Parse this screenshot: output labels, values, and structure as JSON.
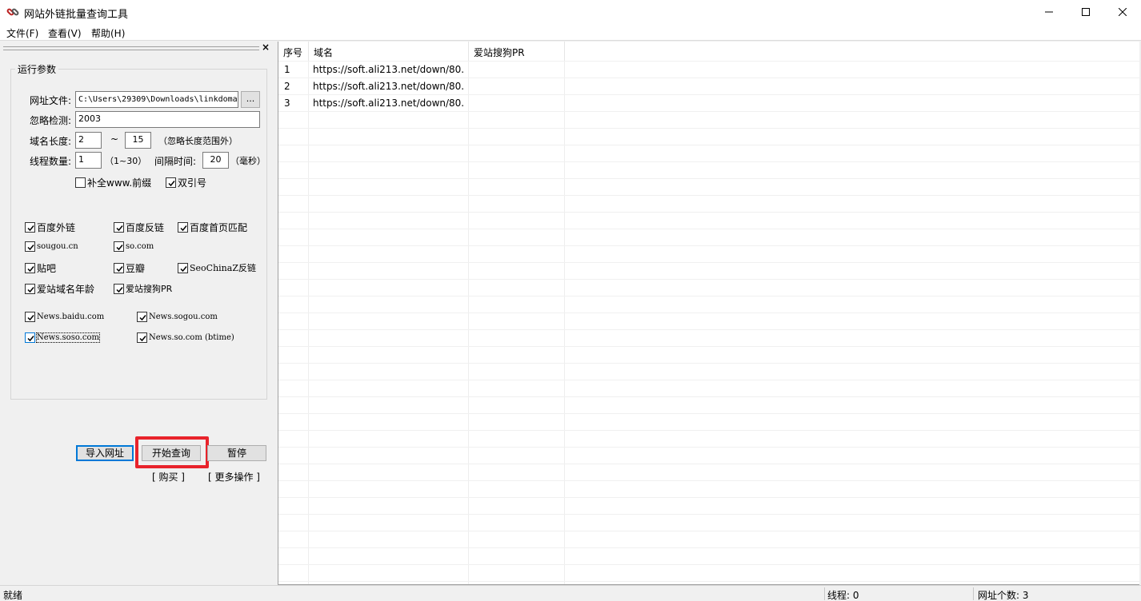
{
  "window": {
    "title": "网站外链批量查询工具",
    "icon": "chain-link-icon"
  },
  "menu": [
    {
      "label": "文件(F)"
    },
    {
      "label": "查看(V)"
    },
    {
      "label": "帮助(H)"
    }
  ],
  "left_pane": {
    "close_glyph": "×",
    "group_title": "运行参数",
    "url_file": {
      "label": "网址文件:",
      "value": "C:\\Users\\29309\\Downloads\\linkdoma",
      "browse_label": "..."
    },
    "ignore_check": {
      "label": "忽略检测:",
      "value": "2003"
    },
    "domain_length": {
      "label": "域名长度:",
      "min": "2",
      "tilde": "~",
      "max": "15",
      "note": "（忽略长度范围外）"
    },
    "threads": {
      "label": "线程数量:",
      "value": "1",
      "range": "（1~30）",
      "interval_label": "间隔时间:",
      "interval_value": "20",
      "unit": "（毫秒）"
    },
    "options": [
      {
        "label": "补全www.前缀",
        "checked": false
      },
      {
        "label": "双引号",
        "checked": true
      }
    ],
    "engines": [
      {
        "label": "百度外链",
        "checked": true
      },
      {
        "label": "百度反链",
        "checked": true
      },
      {
        "label": "百度首页匹配",
        "checked": true
      },
      {
        "label": "sougou.cn",
        "checked": true
      },
      {
        "label": "so.com",
        "checked": true
      },
      {
        "label": "贴吧",
        "checked": true
      },
      {
        "label": "豆瓣",
        "checked": true
      },
      {
        "label": "SeoChinaZ反链",
        "checked": true
      },
      {
        "label": "爱站域名年龄",
        "checked": true
      },
      {
        "label": "爱站搜狗PR",
        "checked": true
      }
    ],
    "news": [
      {
        "label": "News.baidu.com",
        "checked": true
      },
      {
        "label": "News.sogou.com",
        "checked": true
      },
      {
        "label": "News.soso.com",
        "checked": true
      },
      {
        "label": "News.so.com (btime)",
        "checked": true
      }
    ],
    "buttons": {
      "import": "导入网址",
      "start": "开始查询",
      "pause": "暂停"
    },
    "links": {
      "buy": "[ 购买 ]",
      "more": "[ 更多操作 ]"
    }
  },
  "table": {
    "headers": [
      "序号",
      "域名",
      "爱站搜狗PR"
    ],
    "rows": [
      [
        "1",
        "https://soft.ali213.net/down/80...",
        ""
      ],
      [
        "2",
        "https://soft.ali213.net/down/80...",
        ""
      ],
      [
        "3",
        "https://soft.ali213.net/down/80...",
        ""
      ]
    ]
  },
  "status": {
    "ready": "就绪",
    "threads": "线程: 0",
    "url_count": "网址个数: 3"
  },
  "colors": {
    "highlight": "#e8232b",
    "focus_blue": "#0078d7"
  }
}
